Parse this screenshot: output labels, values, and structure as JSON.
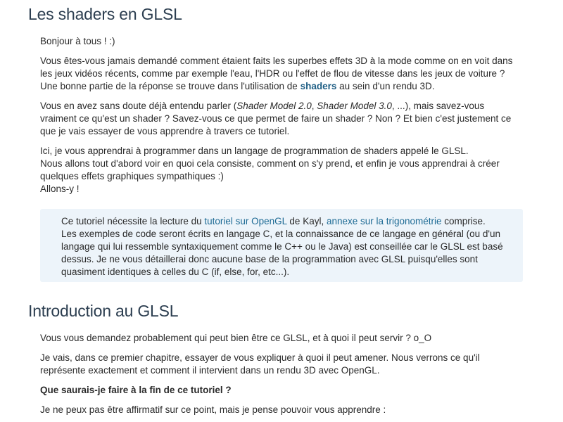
{
  "section1": {
    "title": "Les shaders en GLSL",
    "greeting": "Bonjour à tous ! :)",
    "p1": {
      "line1": "Vous êtes-vous jamais demandé comment étaient faits les superbes effets 3D à la mode comme on en voit dans les jeux vidéos récents, comme par exemple l'eau, l'HDR ou l'effet de flou de vitesse dans les jeux de voiture ?",
      "line2_before": "Une bonne partie de la réponse se trouve dans l'utilisation de ",
      "line2_link": "shaders",
      "line2_after": " au sein d'un rendu 3D."
    },
    "p2": {
      "before": "Vous en avez sans doute déjà entendu parler (",
      "em1": "Shader Model 2.0",
      "sep": ", ",
      "em2": "Shader Model 3.0",
      "after": ", ...), mais savez-vous vraiment ce qu'est un shader ? Savez-vous ce que permet de faire un shader ? Non ? Et bien c'est justement ce que je vais essayer de vous apprendre à travers ce tutoriel."
    },
    "p3": {
      "line1": "Ici, je vous apprendrai à programmer dans un langage de programmation de shaders appelé le GLSL.",
      "line2": "Nous allons tout d'abord voir en quoi cela consiste, comment on s'y prend, et enfin je vous apprendrai à créer quelques effets graphiques sympathiques :)",
      "line3": "Allons-y !"
    },
    "note": {
      "l1_before": "Ce tutoriel nécessite la lecture du ",
      "l1_link1": "tutoriel sur OpenGL",
      "l1_mid": " de Kayl, ",
      "l1_link2": "annexe sur la trigonométrie",
      "l1_after": " comprise.",
      "l2": "Les exemples de code seront écrits en langage C, et la connaissance de ce langage en général (ou d'un langage qui lui ressemble syntaxiquement comme le C++ ou le Java) est conseillée car le GLSL est basé dessus. Je ne vous détaillerai donc aucune base de la programmation avec GLSL puisqu'elles sont quasiment identiques à celles du C (if, else, for, etc...)."
    }
  },
  "section2": {
    "title": "Introduction au GLSL",
    "p1": "Vous vous demandez probablement qui peut bien être ce GLSL, et à quoi il peut servir ? o_O",
    "p2": "Je vais, dans ce premier chapitre, essayer de vous expliquer à quoi il peut amener. Nous verrons ce qu'il représente exactement et comment il intervient dans un rendu 3D avec OpenGL.",
    "p3_bold": "Que saurais-je faire à la fin de ce tutoriel ?",
    "p4": "Je ne peux pas être affirmatif sur ce point, mais je pense pouvoir vous apprendre :"
  }
}
